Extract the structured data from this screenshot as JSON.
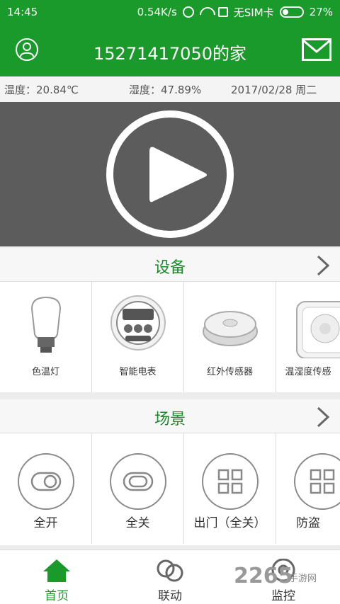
{
  "status_bar": {
    "time": "14:45",
    "speed": "0.54K/s",
    "sim": "无SIM卡",
    "battery": "27%"
  },
  "header": {
    "title": "15271417050的家"
  },
  "info": {
    "temperature": "温度：20.84℃",
    "humidity": "湿度：47.89%",
    "date": "2017/02/28 周二"
  },
  "devices": {
    "title": "设备",
    "items": [
      {
        "label": "色温灯",
        "icon": "bulb-icon"
      },
      {
        "label": "智能电表",
        "icon": "meter-icon"
      },
      {
        "label": "红外传感器",
        "icon": "infrared-sensor-icon"
      },
      {
        "label": "温湿度传感",
        "icon": "humidity-sensor-icon"
      }
    ]
  },
  "scenes": {
    "title": "场景",
    "items": [
      {
        "label": "全开",
        "icon": "toggle-icon"
      },
      {
        "label": "全关",
        "icon": "toggle-icon"
      },
      {
        "label": "出门（全关）",
        "icon": "grid-icon"
      },
      {
        "label": "防盗",
        "icon": "grid-icon"
      }
    ]
  },
  "nav": {
    "items": [
      {
        "label": "首页",
        "icon": "home-icon"
      },
      {
        "label": "联动",
        "icon": "link-icon"
      },
      {
        "label": "监控",
        "icon": "camera-icon"
      }
    ]
  },
  "watermark": {
    "text": "2265",
    "sub": "手游网"
  }
}
